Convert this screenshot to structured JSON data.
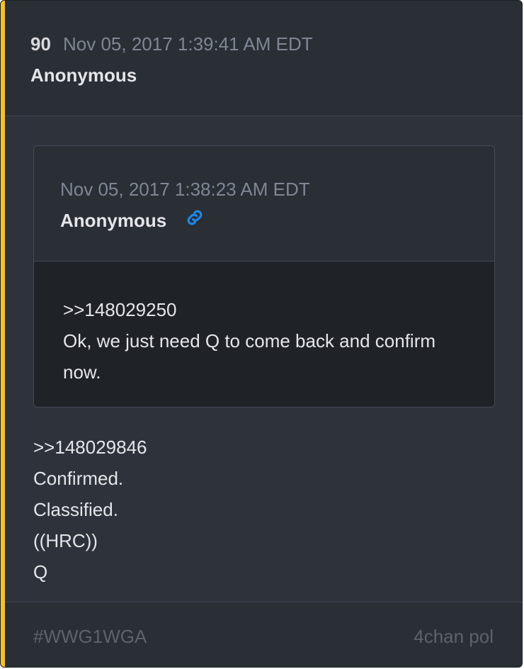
{
  "accent_color": "#f2c12e",
  "link_color": "#1e88e5",
  "post": {
    "number": "90",
    "date": "Nov 05, 2017 1:39:41 AM EDT",
    "author": "Anonymous",
    "body": [
      ">>148029846",
      "Confirmed.",
      "Classified.",
      "((HRC))",
      "Q"
    ]
  },
  "quoted": {
    "date": "Nov 05, 2017 1:38:23 AM EDT",
    "author": "Anonymous",
    "link_icon": "link-icon",
    "body": ">>148029250\nOk, we just need Q to come back and confirm now."
  },
  "footer": {
    "tag": "#WWG1WGA",
    "source": "4chan pol"
  }
}
